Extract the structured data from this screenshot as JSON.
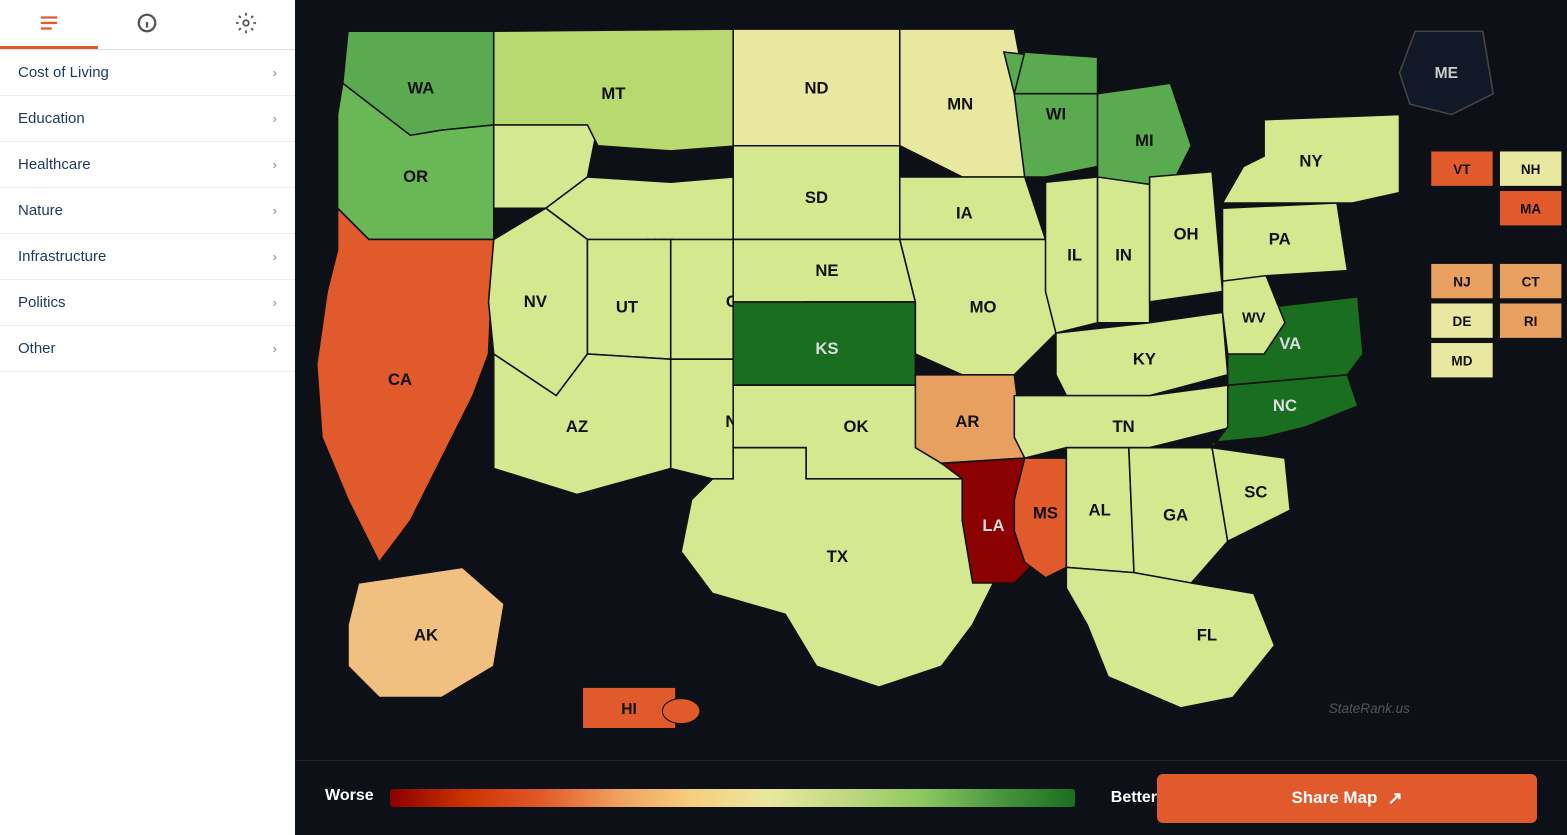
{
  "sidebar": {
    "tabs": [
      {
        "label": "list-icon",
        "icon": "list",
        "active": true
      },
      {
        "label": "info-icon",
        "icon": "info",
        "active": false
      },
      {
        "label": "settings-icon",
        "icon": "settings",
        "active": false
      }
    ],
    "menu_items": [
      {
        "label": "Cost of Living",
        "id": "cost-of-living"
      },
      {
        "label": "Education",
        "id": "education"
      },
      {
        "label": "Healthcare",
        "id": "healthcare"
      },
      {
        "label": "Nature",
        "id": "nature"
      },
      {
        "label": "Infrastructure",
        "id": "infrastructure"
      },
      {
        "label": "Politics",
        "id": "politics"
      },
      {
        "label": "Other",
        "id": "other"
      }
    ]
  },
  "legend": {
    "worse_label": "Worse",
    "better_label": "Better"
  },
  "share_button": {
    "label": "Share Map"
  },
  "watermark": "StateRank.us",
  "states": {
    "WA": {
      "color": "#5aaa50"
    },
    "OR": {
      "color": "#6ab855"
    },
    "CA": {
      "color": "#e05a2b"
    },
    "ID": {
      "color": "#d4e890"
    },
    "NV": {
      "color": "#d4e890"
    },
    "AZ": {
      "color": "#d4e890"
    },
    "MT": {
      "color": "#b8d870"
    },
    "WY": {
      "color": "#d4e890"
    },
    "UT": {
      "color": "#d4e890"
    },
    "CO": {
      "color": "#d4e890"
    },
    "NM": {
      "color": "#d4e890"
    },
    "ND": {
      "color": "#e8e8a0"
    },
    "SD": {
      "color": "#d4e890"
    },
    "NE": {
      "color": "#d4e890"
    },
    "KS": {
      "color": "#1a6e20"
    },
    "OK": {
      "color": "#d4e890"
    },
    "TX": {
      "color": "#d4e890"
    },
    "MN": {
      "color": "#e8e8a0"
    },
    "IA": {
      "color": "#d4e890"
    },
    "MO": {
      "color": "#d4e890"
    },
    "AR": {
      "color": "#e8a060"
    },
    "LA": {
      "color": "#8b0000"
    },
    "WI": {
      "color": "#5aaa50"
    },
    "IL": {
      "color": "#d4e890"
    },
    "IN": {
      "color": "#d4e890"
    },
    "KY": {
      "color": "#d4e890"
    },
    "TN": {
      "color": "#d4e890"
    },
    "MS": {
      "color": "#e05a2b"
    },
    "AL": {
      "color": "#d4e890"
    },
    "MI": {
      "color": "#5aaa50"
    },
    "OH": {
      "color": "#d4e890"
    },
    "WV": {
      "color": "#d4e890"
    },
    "VA": {
      "color": "#1a6e20"
    },
    "NC": {
      "color": "#1a6e20"
    },
    "SC": {
      "color": "#d4e890"
    },
    "GA": {
      "color": "#d4e890"
    },
    "FL": {
      "color": "#d4e890"
    },
    "PA": {
      "color": "#d4e890"
    },
    "NY": {
      "color": "#d4e890"
    },
    "ME": {
      "color": "#0d1117"
    },
    "NH": {
      "color": "#e8e8a0"
    },
    "VT": {
      "color": "#e05a2b"
    },
    "MA": {
      "color": "#e05a2b"
    },
    "RI": {
      "color": "#e8a060"
    },
    "CT": {
      "color": "#e8a060"
    },
    "NJ": {
      "color": "#e8a060"
    },
    "DE": {
      "color": "#e8e8a0"
    },
    "MD": {
      "color": "#e8e8a0"
    },
    "AK": {
      "color": "#f0c080"
    },
    "HI": {
      "color": "#e05a2b"
    }
  }
}
